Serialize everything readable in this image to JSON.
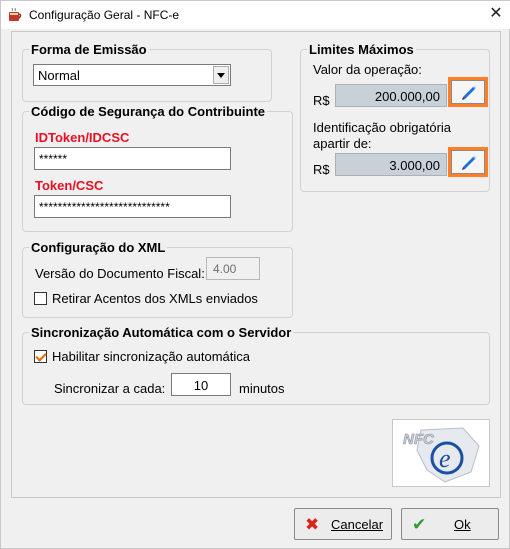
{
  "window": {
    "title": "Configuração Geral - NFC-e",
    "close_glyph": "✕",
    "icon": "app-cup-icon"
  },
  "forma_emissao": {
    "legend": "Forma de Emissão",
    "selected": "Normal"
  },
  "codigo_seguranca": {
    "legend": "Código de Segurança do Contribuinte",
    "idtoken_label": "IDToken/IDCSC",
    "idtoken_value": "******",
    "csc_label": "Token/CSC",
    "csc_value": "****************************"
  },
  "limites": {
    "legend": "Limites Máximos",
    "valor_label": "Valor da operação:",
    "valor_currency": "R$",
    "valor_value": "200.000,00",
    "ident_label_1": "Identificação obrigatória",
    "ident_label_2": "apartir de:",
    "ident_currency": "R$",
    "ident_value": "3.000,00",
    "highlight_color": "#ff7f27"
  },
  "xml": {
    "legend": "Configuração do XML",
    "versao_label": "Versão do Documento Fiscal:",
    "versao_value": "4.00",
    "retirar_label": "Retirar Acentos dos XMLs enviados",
    "retirar_checked": false
  },
  "sync": {
    "legend": "Sincronização Automática com o Servidor",
    "habilitar_label": "Habilitar sincronização automática",
    "habilitar_checked": true,
    "intervalo_label": "Sincronizar a cada:",
    "intervalo_value": "10",
    "intervalo_unit": "minutos"
  },
  "logo": {
    "text": "NFC",
    "letter": "e"
  },
  "buttons": {
    "cancel_label": "Cancelar",
    "ok_label": "Ok",
    "cancel_color": "#d9261c",
    "ok_color": "#2e9e2e"
  }
}
